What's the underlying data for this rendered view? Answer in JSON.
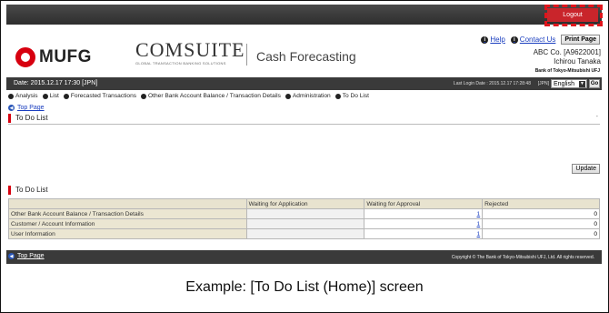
{
  "header": {
    "logout_label": "Logout",
    "brand": "MUFG",
    "product_name": "COMSUITE",
    "product_subtitle": "GLOBAL TRANSACTION BANKING SOLUTIONS",
    "module": "Cash Forecasting",
    "help_label": "Help",
    "contact_label": "Contact Us",
    "print_label": "Print Page",
    "company": "ABC Co. [A9622001]",
    "user": "Ichirou Tanaka",
    "bank": "Bank of Tokyo-Mitsubishi UFJ"
  },
  "infobar": {
    "date": "Date: 2015.12.17 17:30 [JPN]",
    "last_login": "Last Login Date : 2015.12.17 17:28:48",
    "lang_label": "[JPN]",
    "language": "English",
    "go_label": "Go"
  },
  "menu": {
    "items": [
      "Analysis",
      "List",
      "Forecasted Transactions",
      "Other Bank Account Balance / Transaction Details",
      "Administration",
      "To Do List"
    ]
  },
  "breadcrumb": {
    "top_page": "Top Page"
  },
  "section1": {
    "title": "To Do List",
    "collapse": "-"
  },
  "update_label": "Update",
  "section2": {
    "title": "To Do List"
  },
  "table": {
    "headers": [
      "",
      "Waiting for Application",
      "Waiting for Approval",
      "Rejected"
    ],
    "rows": [
      {
        "label": "Other Bank Account Balance / Transaction Details",
        "application": "",
        "approval": "1",
        "rejected": "0"
      },
      {
        "label": "Customer / Account Information",
        "application": "",
        "approval": "1",
        "rejected": "0"
      },
      {
        "label": "User Information",
        "application": "",
        "approval": "1",
        "rejected": "0"
      }
    ]
  },
  "footer": {
    "top_page": "Top Page",
    "copyright": "Copyright © The Bank of Tokyo-Mitsubishi UFJ, Ltd. All rights reserved."
  },
  "caption": "Example: [To Do List (Home)] screen",
  "colors": {
    "accent": "#d7000f",
    "link": "#1a3ebf",
    "bar": "#3a3a3a"
  }
}
